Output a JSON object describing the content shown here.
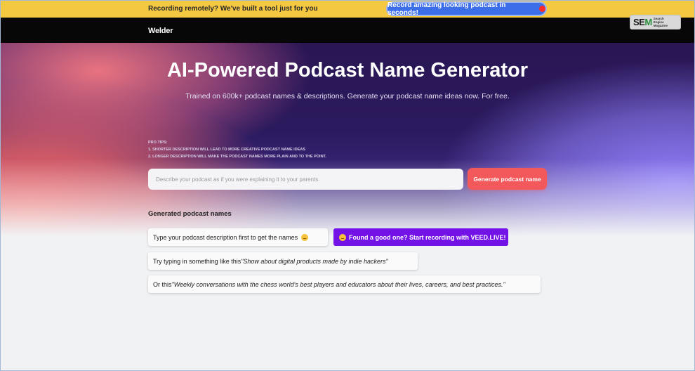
{
  "topbar": {
    "text": "Recording remotely? We've built a tool just for you",
    "cta_label": "Record amazing looking podcast in seconds!"
  },
  "nav": {
    "logo": "Welder"
  },
  "sem_badge": {
    "big": "SEM",
    "small": "SearchEngine Magazine"
  },
  "hero": {
    "title": "AI-Powered Podcast Name Generator",
    "subtitle": "Trained on 600k+ podcast names & descriptions. Generate your podcast name ideas now. For free."
  },
  "tips": {
    "heading": "PRO TIPS:",
    "items": [
      "1. SHORTER DESCRIPTION WILL LEAD TO MORE CREATIVE PODCAST NAME IDEAS",
      "2. LONGER DESCRIPTION WILL MAKE THE PODCAST NAMES MORE PLAIN AND TO THE POINT."
    ]
  },
  "search": {
    "placeholder": "Describe your podcast as if you were explaining it to your parents.",
    "value": "",
    "button_label": "Generate podcast name"
  },
  "results": {
    "label": "Generated podcast names",
    "hint_text": "Type your podcast description first to get the names",
    "veed_label": "Found a good one? Start recording with VEED.LIVE!",
    "example_1_prefix": "Try typing in something like this ",
    "example_1_quote": "\"Show about digital products made by indie hackers\"",
    "example_2_prefix": "Or this ",
    "example_2_quote": "\"Weekly conversations with the chess world's best players and educators about their lives, careers, and best practices.\""
  },
  "colors": {
    "topbar_bg": "#f5c842",
    "cta_bg": "#3b6ee8",
    "generate_btn": "#f3585a",
    "veed_btn": "#7312e6"
  }
}
